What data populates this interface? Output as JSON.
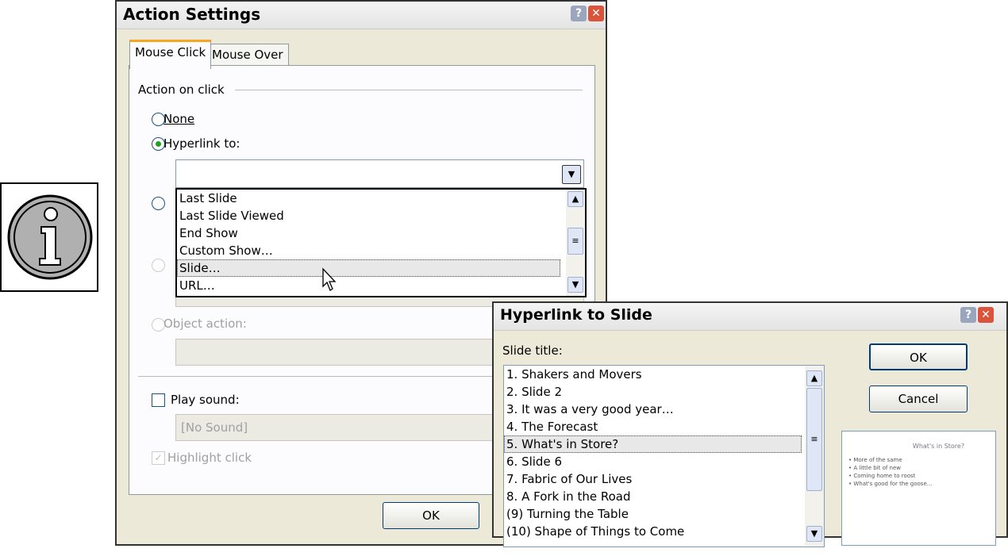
{
  "action_settings": {
    "title": "Action Settings",
    "tabs": [
      {
        "label": "Mouse Click",
        "active": true
      },
      {
        "label": "Mouse Over",
        "active": false
      }
    ],
    "group_label": "Action on click",
    "options": {
      "none": "None",
      "hyperlink": "Hyperlink to:",
      "object_action": "Object action:"
    },
    "hyperlink_value": "",
    "dropdown_items": [
      "Last Slide",
      "Last Slide Viewed",
      "End Show",
      "Custom Show…",
      "Slide…",
      "URL…"
    ],
    "dropdown_selected": "Slide…",
    "play_sound": "Play sound:",
    "sound_value": "[No Sound]",
    "highlight_click": "Highlight click",
    "ok": "OK"
  },
  "hyperlink_dialog": {
    "title": "Hyperlink to Slide",
    "slide_title_label": "Slide title:",
    "slides": [
      "1. Shakers and Movers",
      "2. Slide 2",
      "3. It was a very good year…",
      "4. The Forecast",
      "5. What's in Store?",
      "6. Slide 6",
      "7. Fabric of Our Lives",
      "8. A Fork in the Road",
      "(9) Turning the Table",
      "(10) Shape of Things to Come"
    ],
    "selected": "5. What's in Store?",
    "ok": "OK",
    "cancel": "Cancel",
    "preview": {
      "title": "What's in Store?",
      "bullets": [
        "More of the same",
        "A little bit of new",
        "Coming home to roost",
        "What's good for the goose…"
      ]
    }
  },
  "colors": {
    "dialog_bg": "#ece9d8",
    "tab_accent": "#f6a623",
    "radio_selected": "#21a121",
    "close_button": "#d9543a"
  }
}
